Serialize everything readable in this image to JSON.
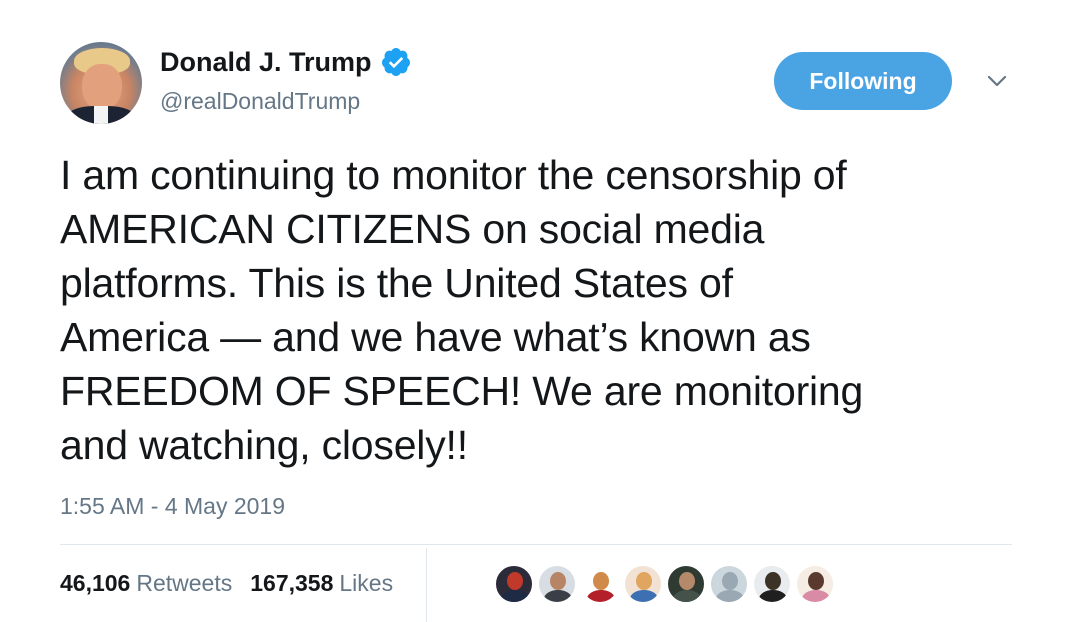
{
  "author": {
    "name": "Donald J. Trump",
    "handle": "@realDonaldTrump",
    "verified_icon": "verified-badge-icon",
    "verified_color": "#1da1f2"
  },
  "header": {
    "follow_label": "Following",
    "follow_color": "#4aa3e3",
    "menu_icon": "chevron-down-icon"
  },
  "tweet": {
    "text": "I am continuing to monitor the censorship of\nAMERICAN CITIZENS on social media\nplatforms. This is the United States of\nAmerica — and we have what’s known as\nFREEDOM OF SPEECH! We are monitoring\nand watching, closely!!",
    "timestamp": "1:55 AM - 4 May 2019"
  },
  "stats": {
    "retweets_count": "46,106",
    "retweets_label": "Retweets",
    "likes_count": "167,358",
    "likes_label": "Likes"
  },
  "likers": [
    {
      "name": "liker-avatar-1",
      "bg": "#2b2b3a",
      "head": "#c0392b",
      "body": "#1f2a44"
    },
    {
      "name": "liker-avatar-2",
      "bg": "#d7dde2",
      "head": "#b88466",
      "body": "#3a3f47"
    },
    {
      "name": "liker-avatar-3",
      "bg": "#ffffff",
      "head": "#d08a4a",
      "body": "#b3202a"
    },
    {
      "name": "liker-avatar-4",
      "bg": "#f2e2d4",
      "head": "#e0a55e",
      "body": "#3d6fb3"
    },
    {
      "name": "liker-avatar-5",
      "bg": "#2f3a33",
      "head": "#b58a6a",
      "body": "#44524a"
    },
    {
      "name": "liker-avatar-6",
      "bg": "#ccd6dd",
      "head": "#9aa8b4",
      "body": "#9aa8b4"
    },
    {
      "name": "liker-avatar-7",
      "bg": "#e8ecef",
      "head": "#3c3326",
      "body": "#1f1f1f"
    },
    {
      "name": "liker-avatar-8",
      "bg": "#f5ece4",
      "head": "#5a3a2e",
      "body": "#d98aa5"
    }
  ]
}
